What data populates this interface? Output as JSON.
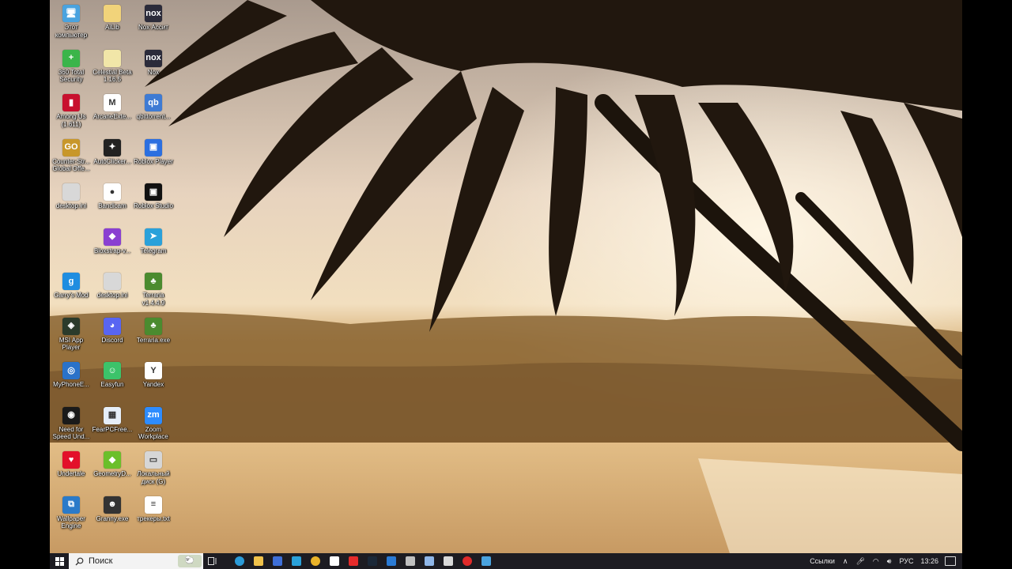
{
  "desktop": {
    "icons": [
      {
        "label": "Этот компьютер",
        "icon": "computer-icon",
        "color": "#4aa3df",
        "glyph": "🖥",
        "col": 0,
        "row": 0
      },
      {
        "label": "AiLib",
        "icon": "folder-icon",
        "color": "#f1d37a",
        "glyph": "",
        "col": 1,
        "row": 0
      },
      {
        "label": "Nox Ассит",
        "icon": "nox-icon",
        "color": "#2b2b3a",
        "glyph": "nox",
        "col": 2,
        "row": 0
      },
      {
        "label": "360 Total Security",
        "icon": "shield-icon",
        "color": "#3bb54a",
        "glyph": "+",
        "col": 0,
        "row": 1
      },
      {
        "label": "Celestial Beta 1.16.5",
        "icon": "file-icon",
        "color": "#f1e6a8",
        "glyph": "",
        "col": 1,
        "row": 1
      },
      {
        "label": "Nox",
        "icon": "nox-icon",
        "color": "#2b2b3a",
        "glyph": "nox",
        "col": 2,
        "row": 1
      },
      {
        "label": "Among Us (1.611)",
        "icon": "among-us-icon",
        "color": "#c8102e",
        "glyph": "▮",
        "col": 0,
        "row": 2
      },
      {
        "label": "ArcaneExte...",
        "icon": "arcane-icon",
        "color": "#ffffff",
        "glyph": "M",
        "col": 1,
        "row": 2
      },
      {
        "label": "qbittorrent...",
        "icon": "qbittorrent-icon",
        "color": "#3e7bd4",
        "glyph": "qb",
        "col": 2,
        "row": 2
      },
      {
        "label": "Counter-Str... Global Offe...",
        "icon": "csgo-icon",
        "color": "#c8972a",
        "glyph": "GO",
        "col": 0,
        "row": 3
      },
      {
        "label": "AutoClicker...",
        "icon": "autoclicker-icon",
        "color": "#222222",
        "glyph": "✦",
        "col": 1,
        "row": 3
      },
      {
        "label": "Roblox Player",
        "icon": "roblox-player-icon",
        "color": "#2b6fe0",
        "glyph": "▣",
        "col": 2,
        "row": 3
      },
      {
        "label": "desktop.ini",
        "icon": "settings-file-icon",
        "color": "#d8d8d8",
        "glyph": "",
        "col": 0,
        "row": 4
      },
      {
        "label": "Bandicam",
        "icon": "bandicam-icon",
        "color": "#ffffff",
        "glyph": "●",
        "col": 1,
        "row": 4
      },
      {
        "label": "Roblox Studio",
        "icon": "roblox-studio-icon",
        "color": "#111111",
        "glyph": "▣",
        "col": 2,
        "row": 4
      },
      {
        "label": "Bloxstrap-v...",
        "icon": "bloxstrap-icon",
        "color": "#8a3fd1",
        "glyph": "◆",
        "col": 1,
        "row": 5
      },
      {
        "label": "Telegram",
        "icon": "telegram-icon",
        "color": "#2aa1da",
        "glyph": "➤",
        "col": 2,
        "row": 5
      },
      {
        "label": "Garry's Mod",
        "icon": "garrys-mod-icon",
        "color": "#1f8de0",
        "glyph": "g",
        "col": 0,
        "row": 6
      },
      {
        "label": "desktop.ini",
        "icon": "settings-file-icon",
        "color": "#d8d8d8",
        "glyph": "",
        "col": 1,
        "row": 6
      },
      {
        "label": "Terraria v1.4.4.9",
        "icon": "terraria-icon",
        "color": "#4b8b2f",
        "glyph": "♣",
        "col": 2,
        "row": 6
      },
      {
        "label": "MSI App Player",
        "icon": "msi-app-player-icon",
        "color": "#2b3b2b",
        "glyph": "◈",
        "col": 0,
        "row": 7
      },
      {
        "label": "Discord",
        "icon": "discord-icon",
        "color": "#5865f2",
        "glyph": "◕",
        "col": 1,
        "row": 7
      },
      {
        "label": "Terraria.exe",
        "icon": "terraria-icon",
        "color": "#4b8b2f",
        "glyph": "♣",
        "col": 2,
        "row": 7
      },
      {
        "label": "MyPhoneE...",
        "icon": "myphoneexplorer-icon",
        "color": "#2a72c9",
        "glyph": "◎",
        "col": 0,
        "row": 8
      },
      {
        "label": "Easyfun",
        "icon": "easyfun-icon",
        "color": "#3cc36a",
        "glyph": "☺",
        "col": 1,
        "row": 8
      },
      {
        "label": "Yandex",
        "icon": "yandex-icon",
        "color": "#ffffff",
        "glyph": "Y",
        "col": 2,
        "row": 8
      },
      {
        "label": "Need for Speed Und...",
        "icon": "nfs-icon",
        "color": "#1a1a1a",
        "glyph": "◉",
        "col": 0,
        "row": 9
      },
      {
        "label": "FearPCFree...",
        "icon": "fearpc-icon",
        "color": "#e6eef8",
        "glyph": "▦",
        "col": 1,
        "row": 9
      },
      {
        "label": "Zoom Workplace",
        "icon": "zoom-icon",
        "color": "#2d8cff",
        "glyph": "zm",
        "col": 2,
        "row": 9
      },
      {
        "label": "Undertale",
        "icon": "undertale-icon",
        "color": "#e3102a",
        "glyph": "♥",
        "col": 0,
        "row": 10
      },
      {
        "label": "GeometryD...",
        "icon": "geometry-dash-icon",
        "color": "#6bbf2a",
        "glyph": "◆",
        "col": 1,
        "row": 10
      },
      {
        "label": "Локальный диск (G)",
        "icon": "drive-icon",
        "color": "#d6d6d6",
        "glyph": "▭",
        "col": 2,
        "row": 10
      },
      {
        "label": "Wallpaper Engine",
        "icon": "wallpaper-engine-icon",
        "color": "#2a7ac9",
        "glyph": "⧉",
        "col": 0,
        "row": 11
      },
      {
        "label": "Granny.exe",
        "icon": "granny-icon",
        "color": "#333333",
        "glyph": "☻",
        "col": 1,
        "row": 11
      },
      {
        "label": "трекеры.txt",
        "icon": "text-file-icon",
        "color": "#ffffff",
        "glyph": "≡",
        "col": 2,
        "row": 11
      }
    ]
  },
  "taskbar": {
    "search_placeholder": "Поиск",
    "apps": [
      {
        "name": "edge-icon",
        "color": "#2b9bd8"
      },
      {
        "name": "file-explorer-icon",
        "color": "#f0c24b"
      },
      {
        "name": "app-window-icon",
        "color": "#3e6fd8"
      },
      {
        "name": "telegram-icon",
        "color": "#2aa1da"
      },
      {
        "name": "chrome-icon",
        "color": "#e9b32a"
      },
      {
        "name": "yandex-browser-icon",
        "color": "#ffffff"
      },
      {
        "name": "yandex-icon",
        "color": "#e52b2b"
      },
      {
        "name": "steam-icon",
        "color": "#1b2838"
      },
      {
        "name": "vscode-icon",
        "color": "#2a7ad4"
      },
      {
        "name": "notepad-icon",
        "color": "#bfbfbf"
      },
      {
        "name": "window-icon",
        "color": "#8fb6e8"
      },
      {
        "name": "camera-icon",
        "color": "#d9d9d9"
      },
      {
        "name": "record-icon",
        "color": "#e02a2a"
      },
      {
        "name": "screen-icon",
        "color": "#4aa3df"
      }
    ],
    "tray": {
      "links_label": "Ссылки",
      "lang": "РУС",
      "time": "13:26"
    }
  }
}
